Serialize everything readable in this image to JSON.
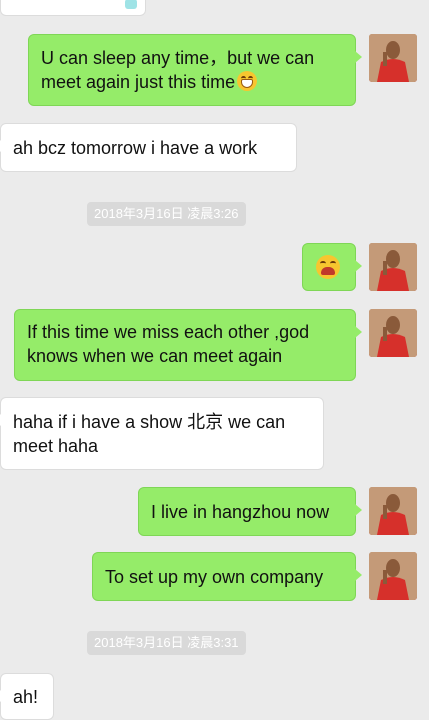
{
  "messages": [
    {
      "id": "m1",
      "side": "out",
      "lines": [
        "U can sleep any time，but we can",
        "meet again just this time"
      ],
      "emoji": "grin"
    },
    {
      "id": "m2",
      "side": "in",
      "lines": [
        "ah bcz tomorrow i have a work"
      ]
    },
    {
      "id": "ts1",
      "type": "timestamp",
      "text": "2018年3月16日 凌晨3:26"
    },
    {
      "id": "m3",
      "side": "out",
      "emoji_only": "laugh"
    },
    {
      "id": "m4",
      "side": "out",
      "lines": [
        "If this time we miss each other ,god",
        "knows when we can meet again"
      ]
    },
    {
      "id": "m5",
      "side": "in",
      "lines": [
        "haha if i have a show 北京 we can",
        "meet haha"
      ]
    },
    {
      "id": "m6",
      "side": "out",
      "lines": [
        "I live in hangzhou now"
      ]
    },
    {
      "id": "m7",
      "side": "out",
      "lines": [
        "To set up my own company"
      ]
    },
    {
      "id": "ts2",
      "type": "timestamp",
      "text": "2018年3月16日 凌晨3:31"
    },
    {
      "id": "m8",
      "side": "in",
      "lines": [
        "ah!"
      ]
    }
  ],
  "colors": {
    "background": "#ebebeb",
    "outgoing_bubble": "#95ec69",
    "incoming_bubble": "#ffffff",
    "timestamp_bg": "#d9d9d9"
  }
}
